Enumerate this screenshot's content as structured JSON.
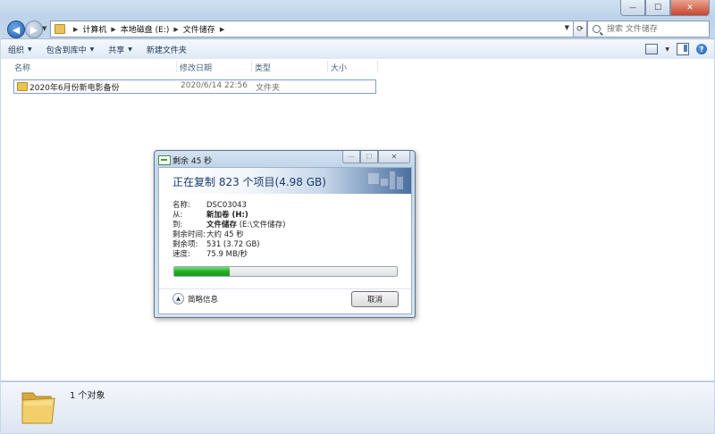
{
  "window": {
    "minimize_glyph": "—",
    "maximize_glyph": "☐",
    "close_glyph": "✕"
  },
  "address": {
    "crumbs": [
      "计算机",
      "本地磁盘 (E:)",
      "文件储存"
    ],
    "search_placeholder": "搜索 文件储存"
  },
  "toolbar": {
    "organize": "组织",
    "include_in_library": "包含到库中",
    "share": "共享",
    "new_folder": "新建文件夹"
  },
  "columns": {
    "name": "名称",
    "date_modified": "修改日期",
    "type": "类型",
    "size": "大小"
  },
  "files": [
    {
      "name": "2020年6月份新电影备份",
      "date": "2020/6/14 22:56",
      "type": "文件夹",
      "size": ""
    }
  ],
  "statusbar": {
    "count_text": "1 个对象"
  },
  "dialog": {
    "title": "剩余 45 秒",
    "headline": "正在复制 823 个项目(4.98 GB)",
    "labels": {
      "name": "名称:",
      "from": "从:",
      "to": "到:",
      "time_remaining": "剩余时间:",
      "items_remaining": "剩余项:",
      "speed": "速度:"
    },
    "values": {
      "name": "DSC03043",
      "from": "新加卷 (H:)",
      "to_bold": "文件储存",
      "to_rest": " (E:\\文件储存)",
      "time_remaining": "大约 45 秒",
      "items_remaining": "531 (3.72 GB)",
      "speed": "75.9 MB/秒"
    },
    "progress_percent": 25,
    "fewer_details": "简略信息",
    "cancel": "取消"
  },
  "colors": {
    "progress_green": "#22b022",
    "headline_blue": "#1c3a6b"
  }
}
